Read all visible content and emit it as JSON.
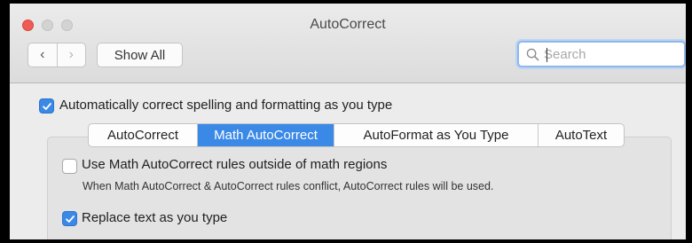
{
  "window": {
    "title": "AutoCorrect"
  },
  "toolbar": {
    "back_glyph": "‹",
    "forward_glyph": "›",
    "show_all_label": "Show All",
    "search_placeholder": "Search"
  },
  "main": {
    "auto_correct_checkbox": {
      "label": "Automatically correct spelling and formatting as you type",
      "checked": true
    },
    "tabs": [
      {
        "label": "AutoCorrect",
        "active": false
      },
      {
        "label": "Math AutoCorrect",
        "active": true
      },
      {
        "label": "AutoFormat as You Type",
        "active": false
      },
      {
        "label": "AutoText",
        "active": false
      }
    ],
    "outside_math_checkbox": {
      "label": "Use Math AutoCorrect rules outside of math regions",
      "checked": false
    },
    "conflict_note": "When Math AutoCorrect & AutoCorrect rules conflict, AutoCorrect rules will be used.",
    "replace_text_checkbox": {
      "label": "Replace text as you type",
      "checked": true
    }
  },
  "colors": {
    "accent": "#3b89e6",
    "close": "#f05b55",
    "window_bg": "#ececec"
  },
  "icons": [
    "close-icon",
    "minimize-icon",
    "zoom-icon",
    "chevron-left-icon",
    "chevron-right-icon",
    "search-icon",
    "checkmark-icon"
  ]
}
